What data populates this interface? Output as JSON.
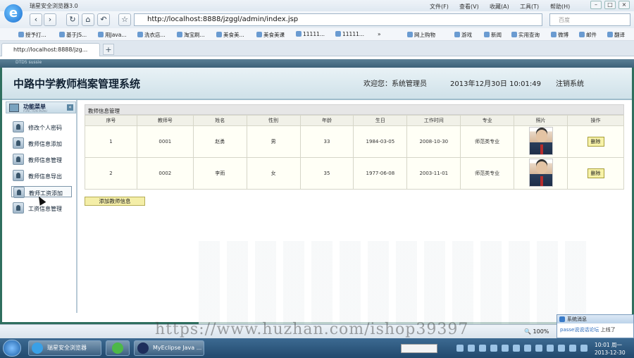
{
  "browser": {
    "app_title": "瑞星安全浏览器3.0",
    "menus": [
      "文件(F)",
      "查看(V)",
      "收藏(A)",
      "工具(T)",
      "帮助(H)"
    ],
    "address": "http://localhost:8888/jzggl/admin/index.jsp",
    "search_placeholder": "百度",
    "favorites": [
      "授予打...",
      "基于JS...",
      "用Java...",
      "洗衣店...",
      "淘宝刷...",
      "美食美...",
      "美食美课",
      "11111...",
      "11111...",
      "网上购物",
      "游戏",
      "新闻",
      "实用查询",
      "微博",
      "邮件",
      "翻译"
    ],
    "tab_title": "http://localhost:8888/jzg...",
    "new_tab": "+",
    "zoom": "100%",
    "frame_strip": "DTD5 sussie"
  },
  "header": {
    "title": "中路中学教师档案管理系统",
    "welcome": "欢迎您：系统管理员",
    "datetime": "2013年12月30日  10:01:49",
    "logout": "注销系统"
  },
  "sidebar": {
    "title": "功能菜单",
    "subtitle": "FUNCTION MENU",
    "items": [
      {
        "label": "修改个人密码"
      },
      {
        "label": "教师信息添加"
      },
      {
        "label": "教师信息管理"
      },
      {
        "label": "教师信息导出"
      },
      {
        "label": "教师工资添加"
      },
      {
        "label": "工资信息管理"
      }
    ]
  },
  "main": {
    "panel_title": "教师信息管理",
    "columns": [
      "序号",
      "教师号",
      "姓名",
      "性别",
      "年龄",
      "生日",
      "工作时间",
      "专业",
      "照片",
      "操作"
    ],
    "rows": [
      {
        "no": "1",
        "teacher_id": "0001",
        "name": "赵勇",
        "gender": "男",
        "age": "33",
        "birthday": "1984-03-05",
        "work_date": "2008-10-30",
        "major": "师范类专业",
        "action": "删除"
      },
      {
        "no": "2",
        "teacher_id": "0002",
        "name": "李雨",
        "gender": "女",
        "age": "35",
        "birthday": "1977-06-08",
        "work_date": "2003-11-01",
        "major": "师范类专业",
        "action": "删除"
      }
    ],
    "add_button": "添加教师信息"
  },
  "notification": {
    "title": "系统消息",
    "body": "passe说说话论坛",
    "body_tail": "上线了"
  },
  "watermark": "https://www.huzhan.com/ishop39397",
  "taskbar": {
    "tasks": [
      "瑞星安全浏览器",
      "",
      "MyEclipse Java ..."
    ],
    "clock_time": "10:01 周一",
    "clock_date": "2013-12-30"
  },
  "colors": {
    "frame_border": "#2f6f5e",
    "header_bg": "#d6e6ee",
    "button_yellow": "#f4eea8"
  }
}
